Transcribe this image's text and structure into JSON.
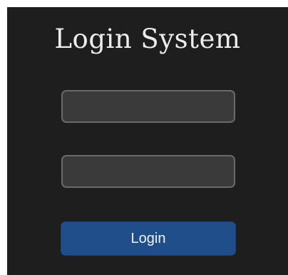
{
  "login": {
    "title": "Login System",
    "username": {
      "value": "",
      "placeholder": ""
    },
    "password": {
      "value": "",
      "placeholder": ""
    },
    "submit_label": "Login",
    "colors": {
      "background": "#1e1e1e",
      "field_bg": "#3a3a3a",
      "field_border": "#6a6a6a",
      "button_bg": "#1f4e8a",
      "text": "#ececec"
    }
  }
}
